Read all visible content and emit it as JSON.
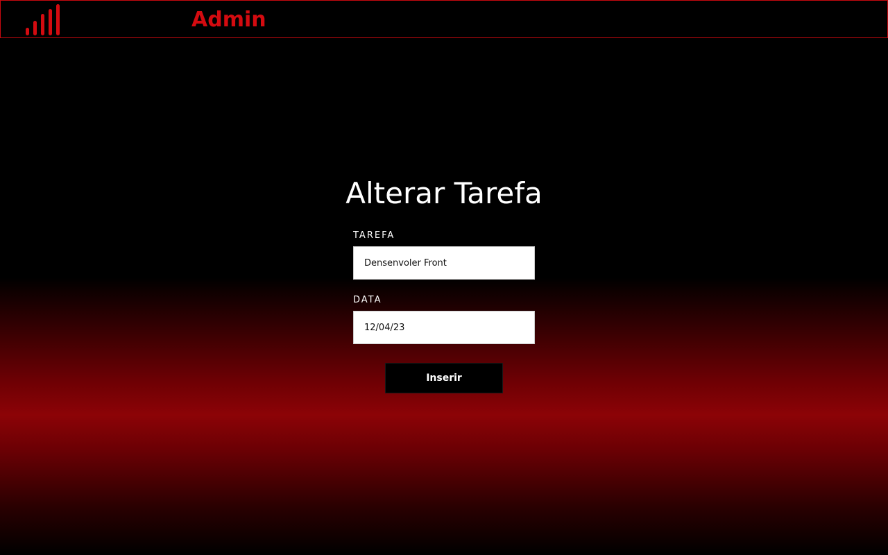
{
  "header": {
    "logo_icon": "signal-bars-icon",
    "brand": "Admin",
    "accent_color": "#d40b10"
  },
  "main": {
    "title": "Alterar Tarefa",
    "form": {
      "task_label": "TAREFA",
      "task_value": "Densenvoler Front",
      "date_label": "DATA",
      "date_value": "12/04/23",
      "submit_label": "Inserir"
    }
  }
}
